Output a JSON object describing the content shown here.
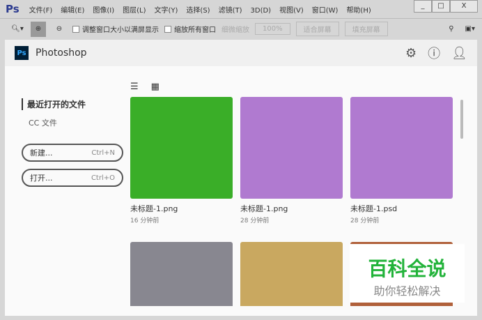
{
  "app": {
    "logo": "Ps",
    "menus": [
      "文件(F)",
      "编辑(E)",
      "图像(I)",
      "图层(L)",
      "文字(Y)",
      "选择(S)",
      "滤镜(T)",
      "3D(D)",
      "视图(V)",
      "窗口(W)",
      "帮助(H)"
    ],
    "win": [
      "_",
      "□",
      "X"
    ]
  },
  "toolbar": {
    "resize_windows": "调整窗口大小以满屏显示",
    "zoom_all": "缩放所有窗口",
    "scrubby": "细微缩放",
    "zoom100": "100%",
    "fit": "适合屏幕",
    "fill": "填充屏幕"
  },
  "home": {
    "title": "Photoshop",
    "logo": "Ps",
    "recent": "最近打开的文件",
    "cc": "CC 文件",
    "new_label": "新建...",
    "new_sc": "Ctrl+N",
    "open_label": "打开...",
    "open_sc": "Ctrl+O"
  },
  "files": [
    {
      "name": "未标题-1.png",
      "time": "16 分钟前",
      "color": "#3aae28"
    },
    {
      "name": "未标题-1.png",
      "time": "28 分钟前",
      "color": "#b07ad0"
    },
    {
      "name": "未标题-1.psd",
      "time": "28 分钟前",
      "color": "#b07ad0"
    },
    {
      "name": "",
      "time": "",
      "color": "#888790"
    },
    {
      "name": "",
      "time": "",
      "color": "#c9a860"
    },
    {
      "name": "",
      "time": "",
      "color": "#b0603a"
    }
  ],
  "watermark": {
    "title": "百科全说",
    "sub": "助你轻松解决"
  }
}
